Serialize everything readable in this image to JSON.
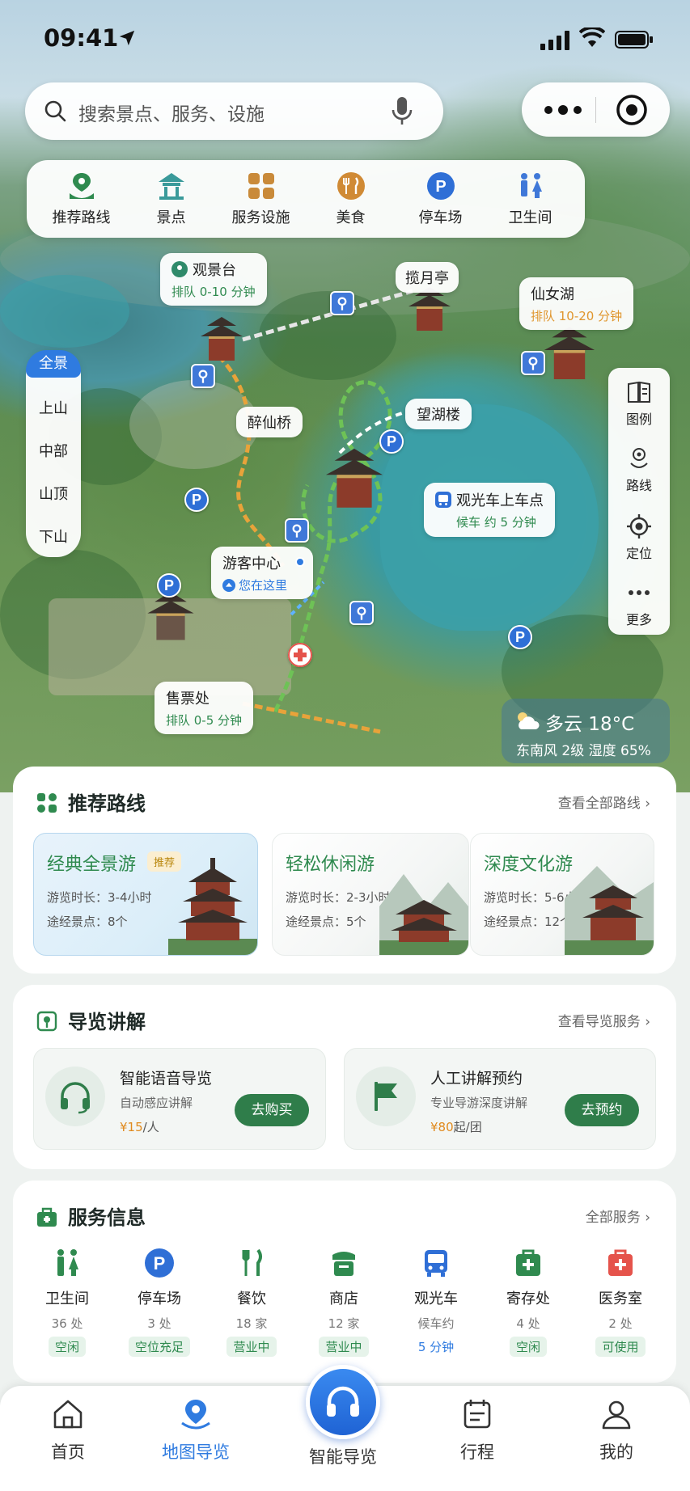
{
  "status_bar": {
    "time": "09:41"
  },
  "search": {
    "placeholder": "搜索景点、服务、设施"
  },
  "categories": [
    {
      "label": "推荐路线",
      "icon": "route-icon"
    },
    {
      "label": "景点",
      "icon": "pavilion-icon"
    },
    {
      "label": "服务设施",
      "icon": "facility-icon"
    },
    {
      "label": "美食",
      "icon": "food-icon"
    },
    {
      "label": "停车场",
      "icon": "parking-icon"
    },
    {
      "label": "卫生间",
      "icon": "restroom-icon"
    }
  ],
  "map_sections": {
    "active": "全景",
    "items": [
      "上山",
      "中部",
      "山顶",
      "下山"
    ]
  },
  "map_tools": [
    {
      "label": "图例",
      "icon": "legend-icon"
    },
    {
      "label": "路线",
      "icon": "route-icon"
    },
    {
      "label": "定位",
      "icon": "locate-icon"
    },
    {
      "label": "更多",
      "icon": "more-icon"
    }
  ],
  "map_labels": {
    "guanjingtai": {
      "name": "观景台",
      "queue": "排队 0-10 分钟"
    },
    "lanyueting": {
      "name": "揽月亭"
    },
    "xiannvhu": {
      "name": "仙女湖",
      "queue": "排队 10-20 分钟"
    },
    "zuixianqiao": {
      "name": "醉仙桥"
    },
    "wanghulou": {
      "name": "望湖楼"
    },
    "shuttle": {
      "name": "观光车上车点",
      "wait": "候车 约 5 分钟"
    },
    "visitor_center": {
      "name": "游客中心",
      "here": "您在这里"
    },
    "ticket": {
      "name": "售票处",
      "queue": "排队 0-5 分钟"
    }
  },
  "weather": {
    "summary": "多云 18°C",
    "detail": "东南风 2级 湿度 65%"
  },
  "recommended_routes": {
    "title": "推荐路线",
    "more": "查看全部路线",
    "items": [
      {
        "name": "经典全景游",
        "badge": "推荐",
        "duration": "游览时长：3-4小时",
        "spots": "途经景点：8个"
      },
      {
        "name": "轻松休闲游",
        "duration": "游览时长：2-3小时",
        "spots": "途经景点：5个"
      },
      {
        "name": "深度文化游",
        "duration": "游览时长：5-6小时",
        "spots": "途经景点：12个"
      }
    ]
  },
  "guide": {
    "title": "导览讲解",
    "more": "查看导览服务",
    "items": [
      {
        "name": "智能语音导览",
        "desc": "自动感应讲解",
        "price": "¥15",
        "unit": "/人",
        "button": "去购买",
        "icon": "headphones-icon"
      },
      {
        "name": "人工讲解预约",
        "desc": "专业导游深度讲解",
        "price": "¥80",
        "unit": "起/团",
        "button": "去预约",
        "icon": "flag-icon"
      }
    ]
  },
  "services": {
    "title": "服务信息",
    "more": "全部服务",
    "items": [
      {
        "name": "卫生间",
        "count": "36 处",
        "status": "空闲",
        "icon": "restroom-icon"
      },
      {
        "name": "停车场",
        "count": "3 处",
        "status": "空位充足",
        "icon": "parking-icon"
      },
      {
        "name": "餐饮",
        "count": "18 家",
        "status": "营业中",
        "icon": "dining-icon"
      },
      {
        "name": "商店",
        "count": "12 家",
        "status": "营业中",
        "icon": "shop-icon"
      },
      {
        "name": "观光车",
        "count": "候车约",
        "status": "5 分钟",
        "icon": "bus-icon"
      },
      {
        "name": "寄存处",
        "count": "4 处",
        "status": "空闲",
        "icon": "locker-icon"
      },
      {
        "name": "医务室",
        "count": "2 处",
        "status": "可使用",
        "icon": "medical-icon"
      }
    ]
  },
  "tabbar": {
    "items": [
      {
        "label": "首页",
        "icon": "home-icon"
      },
      {
        "label": "地图导览",
        "icon": "map-pin-icon",
        "active": true
      },
      {
        "label": "智能导览",
        "icon": "headphones-icon"
      },
      {
        "label": "行程",
        "icon": "calendar-icon"
      },
      {
        "label": "我的",
        "icon": "profile-icon"
      }
    ]
  },
  "colors": {
    "primary_green": "#2f7d4a",
    "accent_blue": "#2f7be0",
    "warning_orange": "#e0962e",
    "medical_red": "#e5534b"
  }
}
